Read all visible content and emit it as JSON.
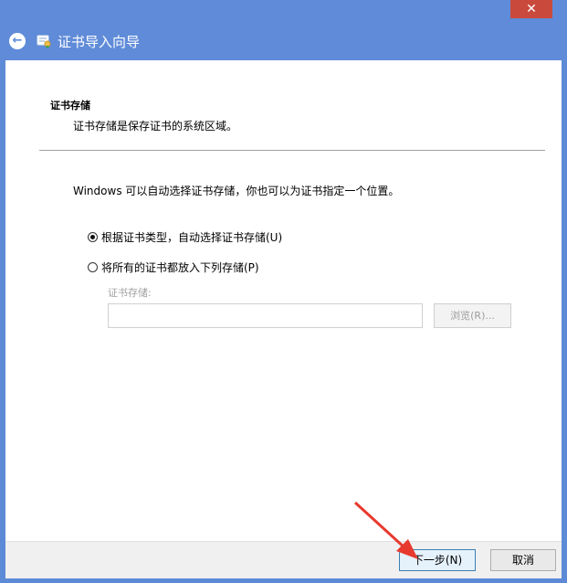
{
  "window": {
    "title": "证书导入向导",
    "close_glyph": "✕",
    "back_glyph": "←"
  },
  "page": {
    "heading": "证书存储",
    "description": "证书存储是保存证书的系统区域。",
    "intro": "Windows 可以自动选择证书存储，你也可以为证书指定一个位置。"
  },
  "options": {
    "auto_label": "根据证书类型，自动选择证书存储(U)",
    "auto_selected": true,
    "manual_label": "将所有的证书都放入下列存储(P)",
    "manual_selected": false,
    "store_label": "证书存储:",
    "store_value": "",
    "browse_label": "浏览(R)..."
  },
  "footer": {
    "next_label": "下一步(N)",
    "cancel_label": "取消"
  },
  "colors": {
    "title_bar": "#5f8bd8",
    "annotation_arrow": "#e8392f"
  }
}
